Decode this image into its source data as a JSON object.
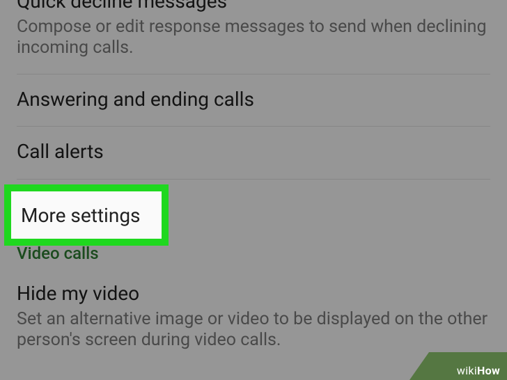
{
  "items": {
    "quick_decline": {
      "title": "Quick decline messages",
      "sub": "Compose or edit response messages to send when declining incoming calls."
    },
    "answering": {
      "title": "Answering and ending calls"
    },
    "call_alerts": {
      "title": "Call alerts"
    },
    "more_settings": {
      "title": "More settings"
    },
    "video_section": {
      "header": "Video calls"
    },
    "hide_video": {
      "title": "Hide my video",
      "sub": "Set an alternative image or video to be displayed on the other person's screen during video calls."
    }
  },
  "callout": {
    "label": "More settings"
  },
  "watermark": {
    "wiki": "wiki",
    "how": "How"
  }
}
